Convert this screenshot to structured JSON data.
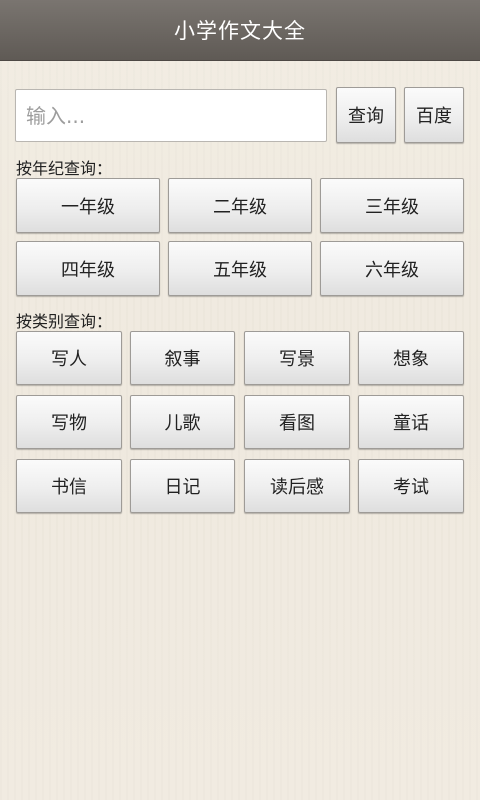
{
  "header": {
    "title": "小学作文大全"
  },
  "search": {
    "placeholder": "输入...",
    "query_label": "查询",
    "baidu_label": "百度"
  },
  "grade_section": {
    "label": "按年纪查询：",
    "grades": [
      "一年级",
      "二年级",
      "三年级",
      "四年级",
      "五年级",
      "六年级"
    ]
  },
  "category_section": {
    "label": "按类别查询：",
    "categories": [
      "写人",
      "叙事",
      "写景",
      "想象",
      "写物",
      "儿歌",
      "看图",
      "童话",
      "书信",
      "日记",
      "读后感",
      "考试"
    ]
  }
}
